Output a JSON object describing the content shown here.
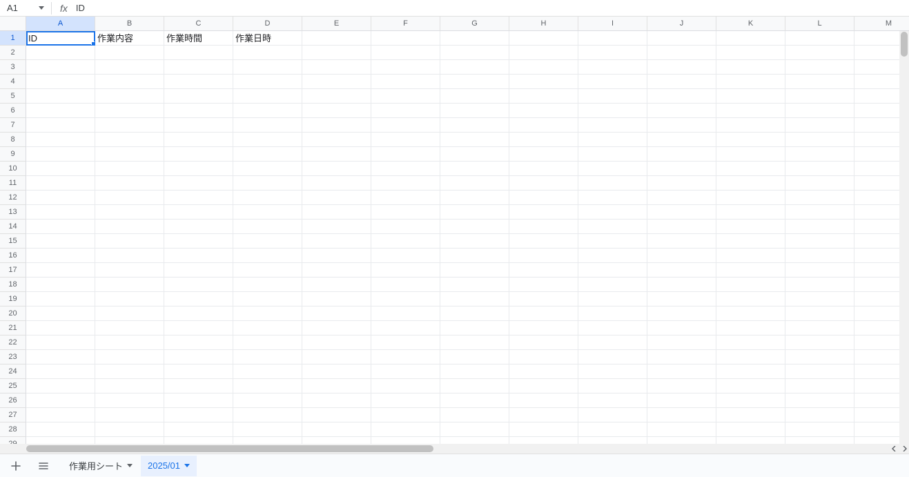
{
  "name_box": {
    "value": "A1"
  },
  "formula": {
    "label": "fx",
    "value": "ID"
  },
  "columns": [
    "A",
    "B",
    "C",
    "D",
    "E",
    "F",
    "G",
    "H",
    "I",
    "J",
    "K",
    "L",
    "M"
  ],
  "rows": 29,
  "active_cell": {
    "row": 1,
    "col": 1
  },
  "cells": {
    "r1c1": "ID",
    "r1c2": "作業内容",
    "r1c3": "作業時間",
    "r1c4": "作業日時"
  },
  "tabs": {
    "add_tooltip": "+",
    "all_tooltip": "≡",
    "items": [
      {
        "label": "作業用シート",
        "active": false
      },
      {
        "label": "2025/01",
        "active": true
      }
    ]
  }
}
